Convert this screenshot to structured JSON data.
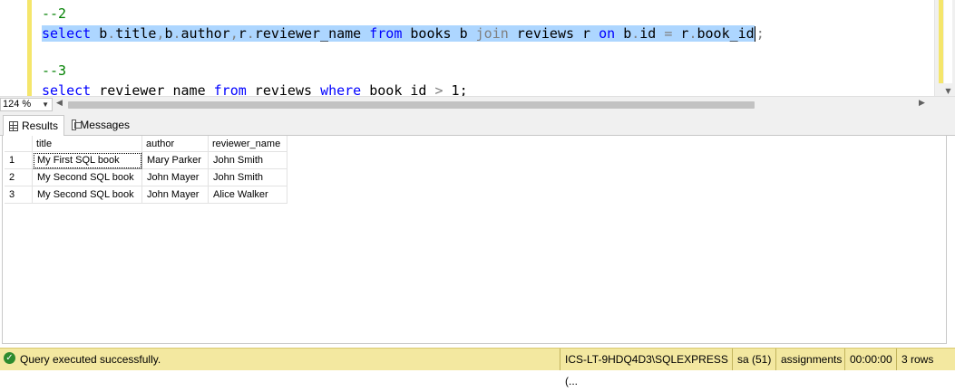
{
  "editor": {
    "line1": "--2",
    "line2": {
      "select": "select",
      "t1": " b",
      "d1": ".",
      "t2": "title",
      "c1": ",",
      "t3": "b",
      "d2": ".",
      "t4": "author",
      "c2": ",",
      "t5": "r",
      "d3": ".",
      "t6": "reviewer_name ",
      "from": "from",
      "t7": " books b ",
      "join": "join",
      "t8": " reviews r ",
      "on": "on",
      "t9": " b",
      "d4": ".",
      "t10": "id ",
      "eq": "=",
      "t11": " r",
      "d5": ".",
      "t12": "book_id",
      "semi": ";"
    },
    "line3": "--3",
    "line4": {
      "select": "select",
      "t1": " reviewer_name ",
      "from": "from",
      "t2": " reviews ",
      "where": "where",
      "t3": " book_id ",
      "gt": ">",
      "t4": " 1;"
    }
  },
  "zoom": {
    "value": "124 %"
  },
  "tabs": [
    {
      "label": "Results",
      "icon": "grid-icon"
    },
    {
      "label": "Messages",
      "icon": "messages-icon"
    }
  ],
  "grid": {
    "columns": [
      "title",
      "author",
      "reviewer_name"
    ],
    "rows": [
      {
        "num": "1",
        "title": "My First SQL book",
        "author": "Mary Parker",
        "reviewer_name": "John Smith"
      },
      {
        "num": "2",
        "title": "My Second SQL book",
        "author": "John Mayer",
        "reviewer_name": "John Smith"
      },
      {
        "num": "3",
        "title": "My Second SQL book",
        "author": "John Mayer",
        "reviewer_name": "Alice Walker"
      }
    ]
  },
  "status": {
    "message": "Query executed successfully.",
    "server": "ICS-LT-9HDQ4D3\\SQLEXPRESS (...",
    "user": "sa (51)",
    "database": "assignments",
    "elapsed": "00:00:00",
    "rows": "3 rows"
  },
  "colors": {
    "status_bg": "#f3e8a0",
    "selection": "#add6ff",
    "keyword": "#0000ff",
    "comment": "#008000"
  }
}
